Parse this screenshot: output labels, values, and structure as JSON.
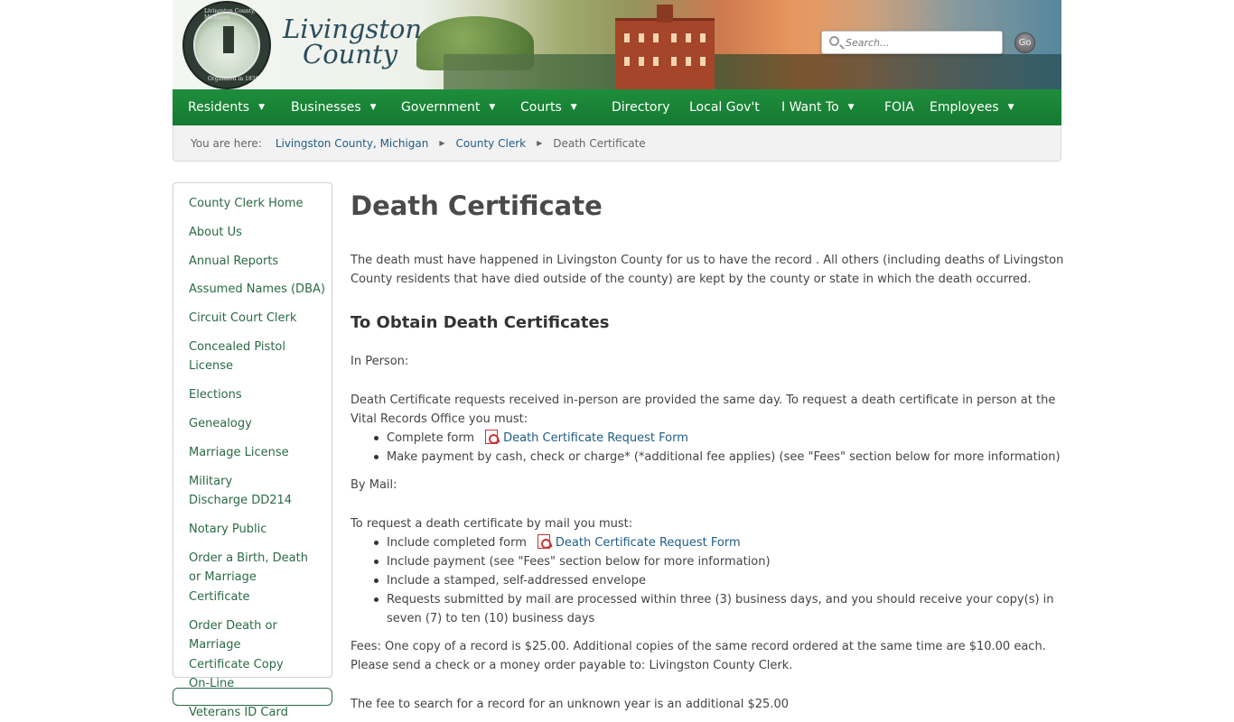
{
  "header": {
    "brand_line1": "Livingston",
    "brand_line2": "County",
    "seal_top": "Livingston County, Michigan",
    "seal_bottom": "Organized in 1836",
    "search_placeholder": "Search...",
    "go_label": "Go"
  },
  "nav": {
    "items": [
      {
        "label": "Residents",
        "has_dropdown": true
      },
      {
        "label": "Businesses",
        "has_dropdown": true
      },
      {
        "label": "Government",
        "has_dropdown": true
      },
      {
        "label": "Courts",
        "has_dropdown": true
      },
      {
        "label": "Directory",
        "has_dropdown": false
      },
      {
        "label": "Local Gov't",
        "has_dropdown": false
      },
      {
        "label": "I Want To",
        "has_dropdown": true
      },
      {
        "label": "FOIA",
        "has_dropdown": false
      },
      {
        "label": "Employees",
        "has_dropdown": true
      }
    ],
    "arrow": "▼"
  },
  "breadcrumb": {
    "label": "You are here:",
    "sep": "▶",
    "items": [
      "Livingston County, Michigan",
      "County Clerk"
    ],
    "current": "Death Certificate"
  },
  "sidebar": {
    "items": [
      "County Clerk Home",
      "About Us",
      "Annual Reports",
      "Assumed Names (DBA)",
      "Circuit Court Clerk",
      "Concealed Pistol License",
      "Elections",
      "Genealogy",
      "Marriage License",
      "Military Discharge DD214",
      "Notary Public",
      "Order a Birth, Death or Marriage Certificate",
      "Order Death or Marriage Certificate Copy On-Line",
      "Veterans ID Card"
    ]
  },
  "main": {
    "title": "Death Certificate",
    "intro": "The death must have happened in Livingston County for us to have the record . All others (including deaths of Livingston County residents that have died outside of the county) are kept by the county or state in which the death occurred.",
    "obtain_heading": "To Obtain Death Certificates",
    "in_person_label": "In Person:",
    "in_person_text": "Death Certificate requests received in-person are provided the same day. To request a death certificate in person at the Vital Records Office you must:",
    "in_person_list": {
      "item1_prefix": "Complete form",
      "item1_link": "Death Certificate Request Form",
      "item2": "Make payment by cash, check or charge* (*additional fee applies) (see \"Fees\" section below for more information)"
    },
    "by_mail_label": "By Mail:",
    "by_mail_text": "To request a death certificate by mail you must:",
    "by_mail_list": {
      "item1_prefix": "Include completed form",
      "item1_link": "Death Certificate Request Form",
      "item2": "Include payment (see \"Fees\" section below for more information)",
      "item3": "Include a stamped, self-addressed envelope",
      "item4": "Requests submitted by mail are processed within three (3) business days, and you should receive your copy(s) in seven (7) to ten (10) business days"
    },
    "fees": "Fees: One copy of a record is $25.00. Additional copies of the same record ordered at the same time are $10.00 each. Please send a check or a money order payable to: Livingston County Clerk.",
    "fees_search": "The fee to search for a record for an unknown year is an additional $25.00"
  }
}
